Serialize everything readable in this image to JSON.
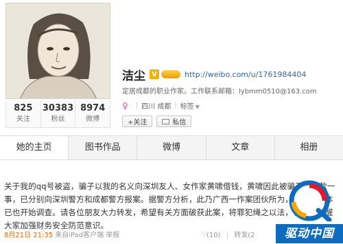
{
  "profile": {
    "name": "洁尘",
    "verified_badge": "V",
    "url": "http://weibo.com/u/1761984404",
    "description": "定居成都的职业作家。工作联系邮箱：lybmm0510@163.com",
    "gender_icon": "female-icon",
    "location": "四川 成都",
    "tags_label": "标签",
    "stats": [
      {
        "value": "825",
        "label": "关注"
      },
      {
        "value": "30383",
        "label": "粉丝"
      },
      {
        "value": "8974",
        "label": "微博"
      }
    ],
    "follow_button": "+关注",
    "message_button": "私信"
  },
  "nav": {
    "tabs": [
      "她的主页",
      "图书作品",
      "微博",
      "文章",
      "相册"
    ]
  },
  "post": {
    "text": "关于我的qq号被盗，骗子以我的名义向深圳友人、女作家黄啸借钱，黄啸因此被骗了一笔款一事，已分别向深圳警方和成都警方报案。据警方分析，此乃广西一作案团伙所为，警方和媒体已也开始调查。请各位朋友大力转发，希望有关方面破获此案，将罪犯绳之以法，也以此提醒大家加强财务安全防范意识。",
    "date": "8月21日 21:35",
    "source": "来自iPad客户端",
    "report": "举报",
    "likes": "(10)",
    "repost": "转发(2",
    "colors": {
      "date": "#ec6b00",
      "link": "#3366aa"
    }
  },
  "watermark": {
    "text": "驱动中国",
    "color": "#0e6cc0"
  }
}
